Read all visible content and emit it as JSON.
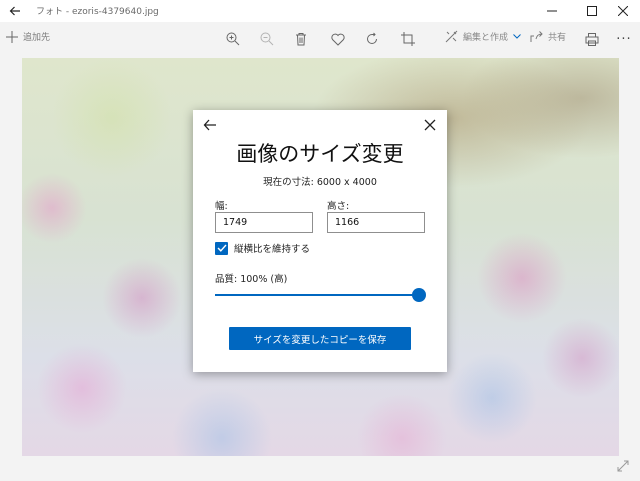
{
  "window": {
    "title": "フォト - ezoris-4379640.jpg"
  },
  "toolbar": {
    "add_label": "追加先",
    "edit_label": "編集と作成",
    "share_label": "共有",
    "more_label": "···"
  },
  "dialog": {
    "title": "画像のサイズ変更",
    "current_size": "現在の寸法: 6000 x 4000",
    "width_label": "幅:",
    "width_value": "1749",
    "height_label": "高さ:",
    "height_value": "1166",
    "aspect_label": "縦横比を維持する",
    "aspect_checked": true,
    "quality_label": "品質: 100% (高)",
    "quality_value": 1.0,
    "save_label": "サイズを変更したコピーを保存"
  },
  "colors": {
    "accent": "#0067c0"
  }
}
